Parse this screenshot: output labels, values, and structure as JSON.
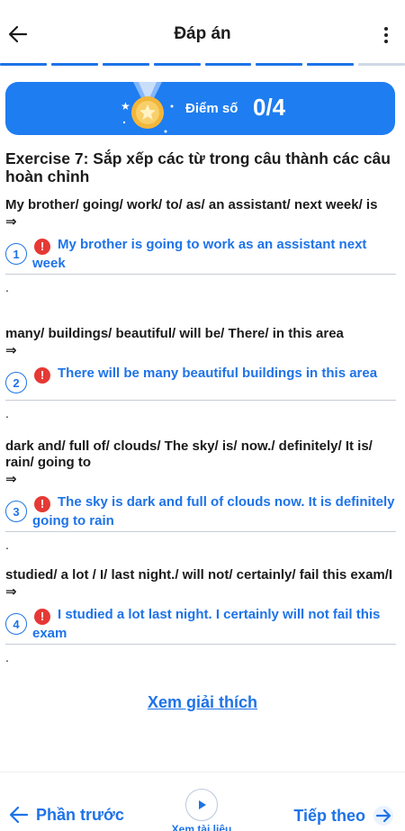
{
  "header": {
    "title": "Đáp án"
  },
  "progress": {
    "segments_total": 8,
    "segments_done": 7
  },
  "score": {
    "label": "Điểm số",
    "value": "0/4"
  },
  "exercise": {
    "title": "Exercise 7: Sắp xếp các từ trong câu thành các câu hoàn chỉnh"
  },
  "questions": [
    {
      "number": "1",
      "prompt": "My brother/ going/ work/ to/ as/ an assistant/ next week/ is",
      "arrow": "⇒",
      "answer": "My brother is going to work as an assistant next week",
      "dot": "."
    },
    {
      "number": "2",
      "prompt": "many/ buildings/ beautiful/ will be/ There/ in this area",
      "arrow": "⇒",
      "answer": "There will be many beautiful buildings in this area",
      "dot": "."
    },
    {
      "number": "3",
      "prompt": "dark and/ full of/ clouds/ The sky/ is/ now./ definitely/ It is/ rain/ going to",
      "arrow": "⇒",
      "answer": "The sky is dark and full of clouds now. It is definitely going to rain",
      "dot": "."
    },
    {
      "number": "4",
      "prompt": "studied/ a lot / I/ last night./ will not/ certainly/ fail this exam/I",
      "arrow": "⇒",
      "answer": "I studied a lot last night. I certainly will not fail this exam",
      "dot": "."
    }
  ],
  "explain_link": "Xem giải thích",
  "footer": {
    "prev_label": "Phần trước",
    "doc_label": "Xem tài liệu",
    "next_label": "Tiếp theo"
  },
  "colors": {
    "accent": "#1e73e8",
    "banner": "#1e7df0",
    "error": "#e53935"
  }
}
